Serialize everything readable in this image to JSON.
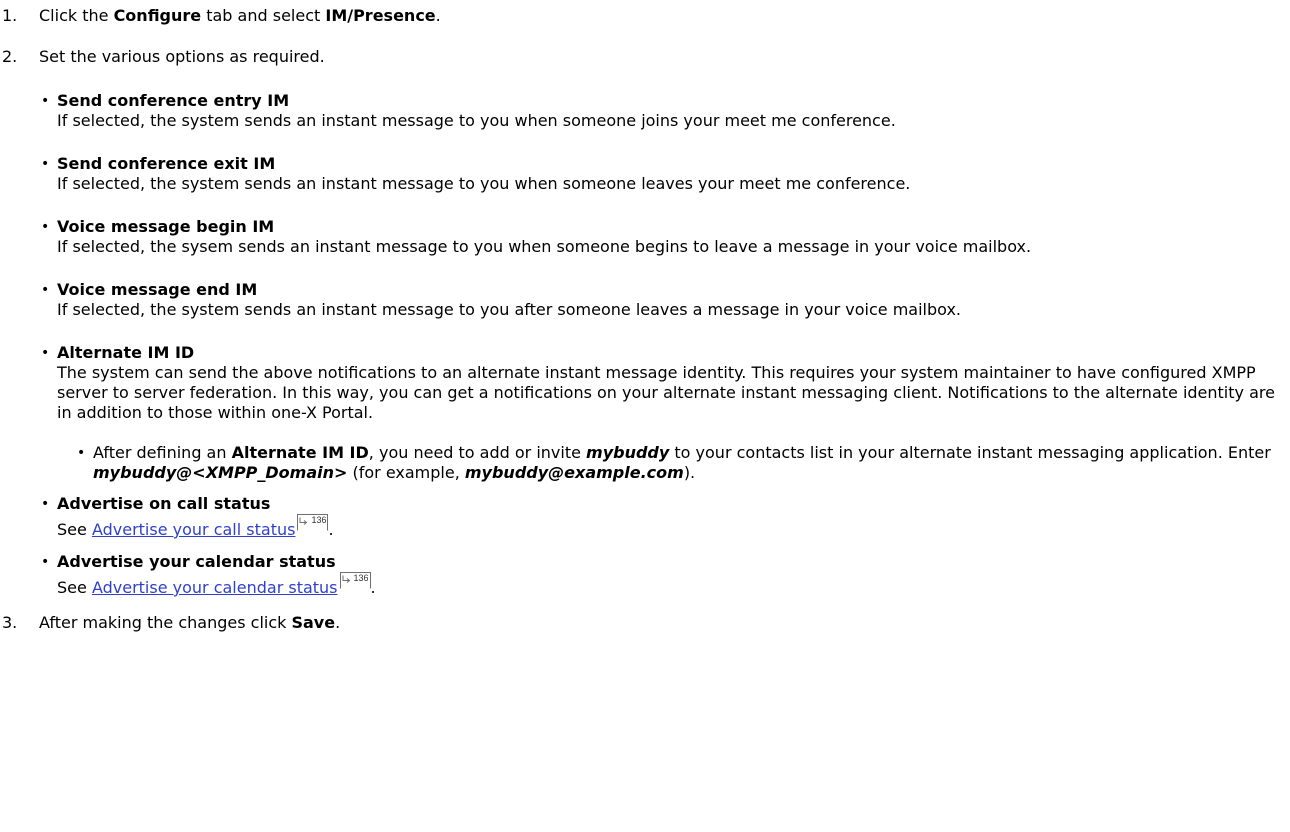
{
  "steps": [
    {
      "num": "1.",
      "pre": "Click the ",
      "b1": "Configure",
      "mid": " tab and select ",
      "b2": "IM/Presence",
      "post": "."
    },
    {
      "num": "2.",
      "text": "Set the various options as required."
    },
    {
      "num": "3.",
      "pre": "After making the changes click ",
      "b1": "Save",
      "post": "."
    }
  ],
  "options": {
    "entry": {
      "title": "Send conference entry IM",
      "desc": "If selected, the system sends an instant message to you when someone joins your meet me conference."
    },
    "exit": {
      "title": "Send conference exit IM",
      "desc": "If selected, the system sends an instant message to you when someone leaves your meet me conference."
    },
    "vm_begin": {
      "title": "Voice message begin IM",
      "desc": "If selected, the sysem sends an instant message to you when someone begins to leave a message in your voice mailbox."
    },
    "vm_end": {
      "title": "Voice message end IM",
      "desc": "If selected, the system sends an instant message to you after someone leaves a message in your voice mailbox."
    },
    "alt": {
      "title": "Alternate IM ID",
      "desc": "The system can send the above notifications to an alternate instant message identity. This requires your system maintainer to have configured XMPP server to server federation. In this way, you can get a notifications on your alternate instant messaging client. Notifications to the alternate identity are in addition to  those within one-X Portal.",
      "sub": {
        "p1": "After defining an ",
        "b1": "Alternate IM ID",
        "p2": ", you need to add or invite ",
        "bi1": "mybuddy",
        "p3": " to your contacts list in your alternate instant messaging application. Enter ",
        "bi2": "mybuddy@<XMPP_Domain>",
        "p4": " (for example, ",
        "bi3": "mybuddy@example.com",
        "p5": ")."
      }
    },
    "adv_call": {
      "title": "Advertise on call status",
      "see": "See ",
      "link": "Advertise your call status",
      "page": "136",
      "end": "."
    },
    "adv_cal": {
      "title": "Advertise your calendar status",
      "see": "See ",
      "link": "Advertise your calendar status",
      "page": "136",
      "end": "."
    }
  },
  "bullet": "•",
  "icon": "page-reference-icon"
}
